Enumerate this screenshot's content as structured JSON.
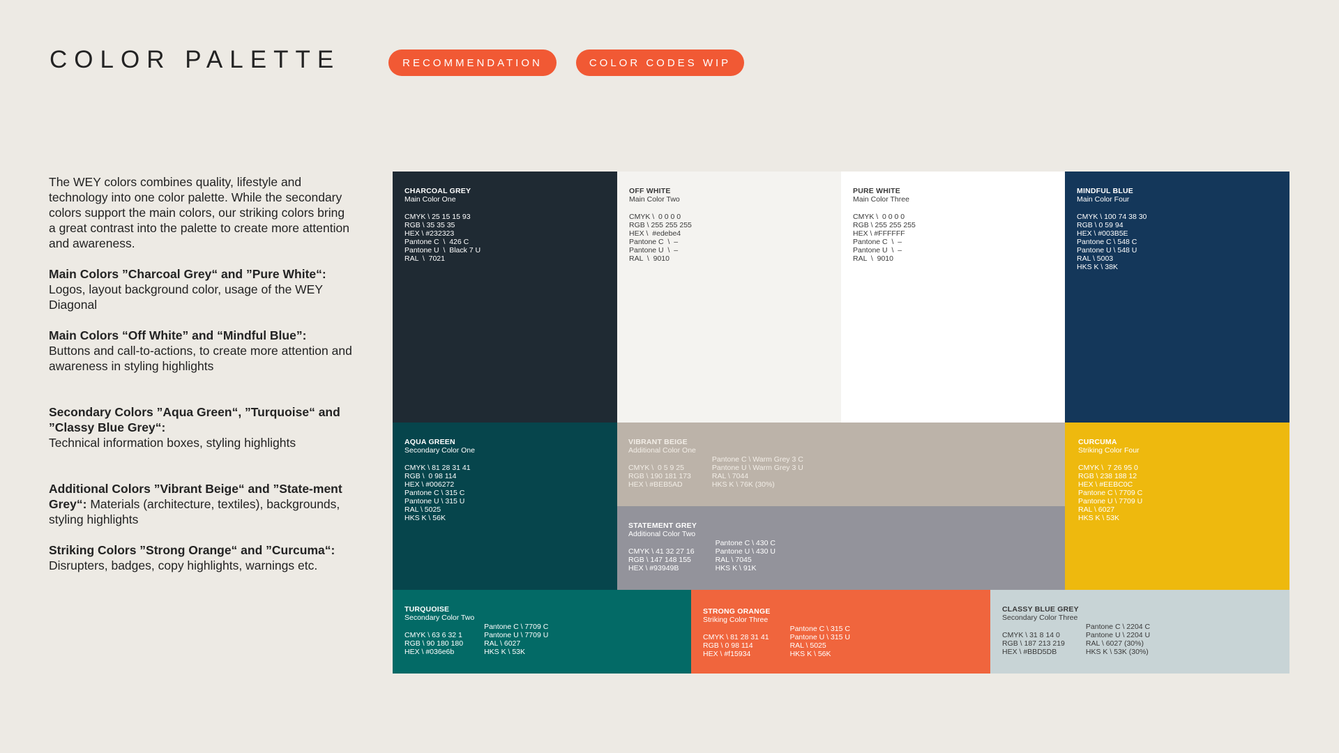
{
  "header": {
    "title": "COLOR PALETTE",
    "tags": [
      "RECOMMENDATION",
      "COLOR CODES WIP"
    ]
  },
  "description": {
    "intro": "The WEY colors combines quality, lifestyle and technology into one color palette. While the secondary colors support the main colors, our striking colors bring a great contrast into the palette to create more attention and awareness.",
    "sections": [
      {
        "heading": "Main Colors ”Charcoal Grey“ and ”Pure White“:",
        "text": "Logos, layout background color, usage of the WEY Diagonal"
      },
      {
        "heading": "Main Colors “Off White” and  “Mindful Blue”:",
        "text": "Buttons and call-to-actions, to create more attention and awareness in styling highlights"
      },
      {
        "heading": "Secondary Colors ”Aqua Green“, ”Turquoise“ and ”Classy Blue Grey“:",
        "text": "Technical information boxes, styling highlights"
      },
      {
        "heading": "Additional Colors  ”Vibrant Beige“ and ”State-ment Grey“:",
        "text": "Materials (architecture, textiles), backgrounds, styling highlights"
      },
      {
        "heading": "Striking Colors  ”Strong Orange“ and ”Curcuma“:",
        "text": "Disrupters, badges, copy highlights, warnings etc."
      }
    ]
  },
  "swatches": [
    {
      "name": "CHARCOAL GREY",
      "sub": "Main Color One",
      "color": "#232323",
      "bg": "#1f2a33",
      "codes": [
        "CMYK \\ 25 15 15 93",
        "RGB \\ 35 35 35",
        "HEX \\ #232323",
        "Pantone C  \\  426 C",
        "Pantone U  \\  Black 7 U",
        "RAL  \\  7021"
      ],
      "codes2": []
    },
    {
      "name": "OFF WHITE",
      "sub": "Main Color Two",
      "color": "#edebe4",
      "bg": "#f4f3f0",
      "codes": [
        "CMYK \\  0 0 0 0",
        "RGB \\ 255 255 255",
        "HEX \\  #edebe4",
        "Pantone C  \\  –",
        "Pantone U  \\  –",
        "RAL  \\  9010"
      ],
      "codes2": []
    },
    {
      "name": "PURE WHITE",
      "sub": "Main Color Three",
      "color": "#FFFFFF",
      "bg": "#ffffff",
      "codes": [
        "CMYK \\  0 0 0 0",
        "RGB \\ 255 255 255",
        "HEX \\ #FFFFFF",
        "Pantone C  \\  –",
        "Pantone U  \\  –",
        "RAL  \\  9010"
      ],
      "codes2": []
    },
    {
      "name": "MINDFUL BLUE",
      "sub": "Main  Color Four",
      "color": "#003B5E",
      "bg": "#14375a",
      "codes": [
        "CMYK \\ 100 74 38 30",
        "RGB \\ 0 59 94",
        "HEX \\ #003B5E",
        "Pantone C \\ 548 C",
        "Pantone U \\ 548 U",
        "RAL \\ 5003",
        "HKS K \\ 38K"
      ],
      "codes2": []
    },
    {
      "name": "AQUA GREEN",
      "sub": "Secondary Color One",
      "color": "#006272",
      "bg": "#06454c",
      "codes": [
        "CMYK \\ 81 28 31 41",
        "RGB \\  0 98 114",
        "HEX \\ #006272",
        "Pantone C \\ 315 C",
        "Pantone U \\ 315 U",
        "RAL \\ 5025",
        "HKS K \\ 56K"
      ],
      "codes2": []
    },
    {
      "name": "VIBRANT BEIGE",
      "sub": "Additional Color One",
      "color": "#BEB5AD",
      "bg": "#bcb3a9",
      "codes": [
        "CMYK \\  0 5 9 25",
        "RGB \\ 190 181 173",
        "HEX \\ #BEB5AD"
      ],
      "codes2": [
        "Pantone C \\ Warm Grey 3 C",
        "Pantone U \\ Warm Grey 3 U",
        "RAL \\ 7044",
        "HKS K \\ 76K (30%)"
      ]
    },
    {
      "name": "CURCUMA",
      "sub": "Striking Color Four",
      "color": "#EEBC0C",
      "bg": "#eeb90e",
      "codes": [
        "CMYK \\  7 26 95 0",
        "RGB \\ 238 188 12",
        "HEX \\ #EEBC0C",
        "Pantone C \\ 7709 C",
        "Pantone U \\ 7709 U",
        "RAL \\ 6027",
        "HKS K \\ 53K"
      ],
      "codes2": []
    },
    {
      "name": "STATEMENT GREY",
      "sub": "Additional Color Two",
      "color": "#93949B",
      "bg": "#93939b",
      "codes": [
        "CMYK \\ 41 32 27 16",
        "RGB \\ 147 148 155",
        "HEX \\ #93949B"
      ],
      "codes2": [
        "Pantone C \\ 430 C",
        "Pantone U \\ 430 U",
        "RAL \\ 7045",
        "HKS K \\ 91K"
      ]
    },
    {
      "name": "TURQUOISE",
      "sub": "Secondary Color Two",
      "color": "#036e6b",
      "bg": "#036a66",
      "codes": [
        "CMYK \\ 63 6 32 1",
        "RGB \\ 90 180 180",
        "HEX \\ #036e6b"
      ],
      "codes2": [
        "Pantone C \\ 7709 C",
        "Pantone U \\ 7709 U",
        "RAL \\ 6027",
        "HKS K \\ 53K"
      ]
    },
    {
      "name": "STRONG ORANGE",
      "sub": "Striking Color Three",
      "color": "#f15934",
      "bg": "#f0653d",
      "codes": [
        "CMYK \\ 81 28 31 41",
        "RGB \\ 0 98 114",
        "HEX \\ #f15934"
      ],
      "codes2": [
        "Pantone C \\ 315 C",
        "Pantone U \\ 315 U",
        "RAL \\ 5025",
        "HKS K \\ 56K"
      ]
    },
    {
      "name": "CLASSY BLUE GREY",
      "sub": "Secondary Color Three",
      "color": "#BBD5DB",
      "bg": "#c8d4d6",
      "codes": [
        "CMYK \\ 31 8 14 0",
        "RGB \\ 187 213 219",
        "HEX \\ #BBD5DB"
      ],
      "codes2": [
        "Pantone C \\ 2204 C",
        "Pantone U \\ 2204 U",
        "RAL \\ 6027 (30%)",
        "HKS K \\ 53K (30%)"
      ]
    }
  ]
}
